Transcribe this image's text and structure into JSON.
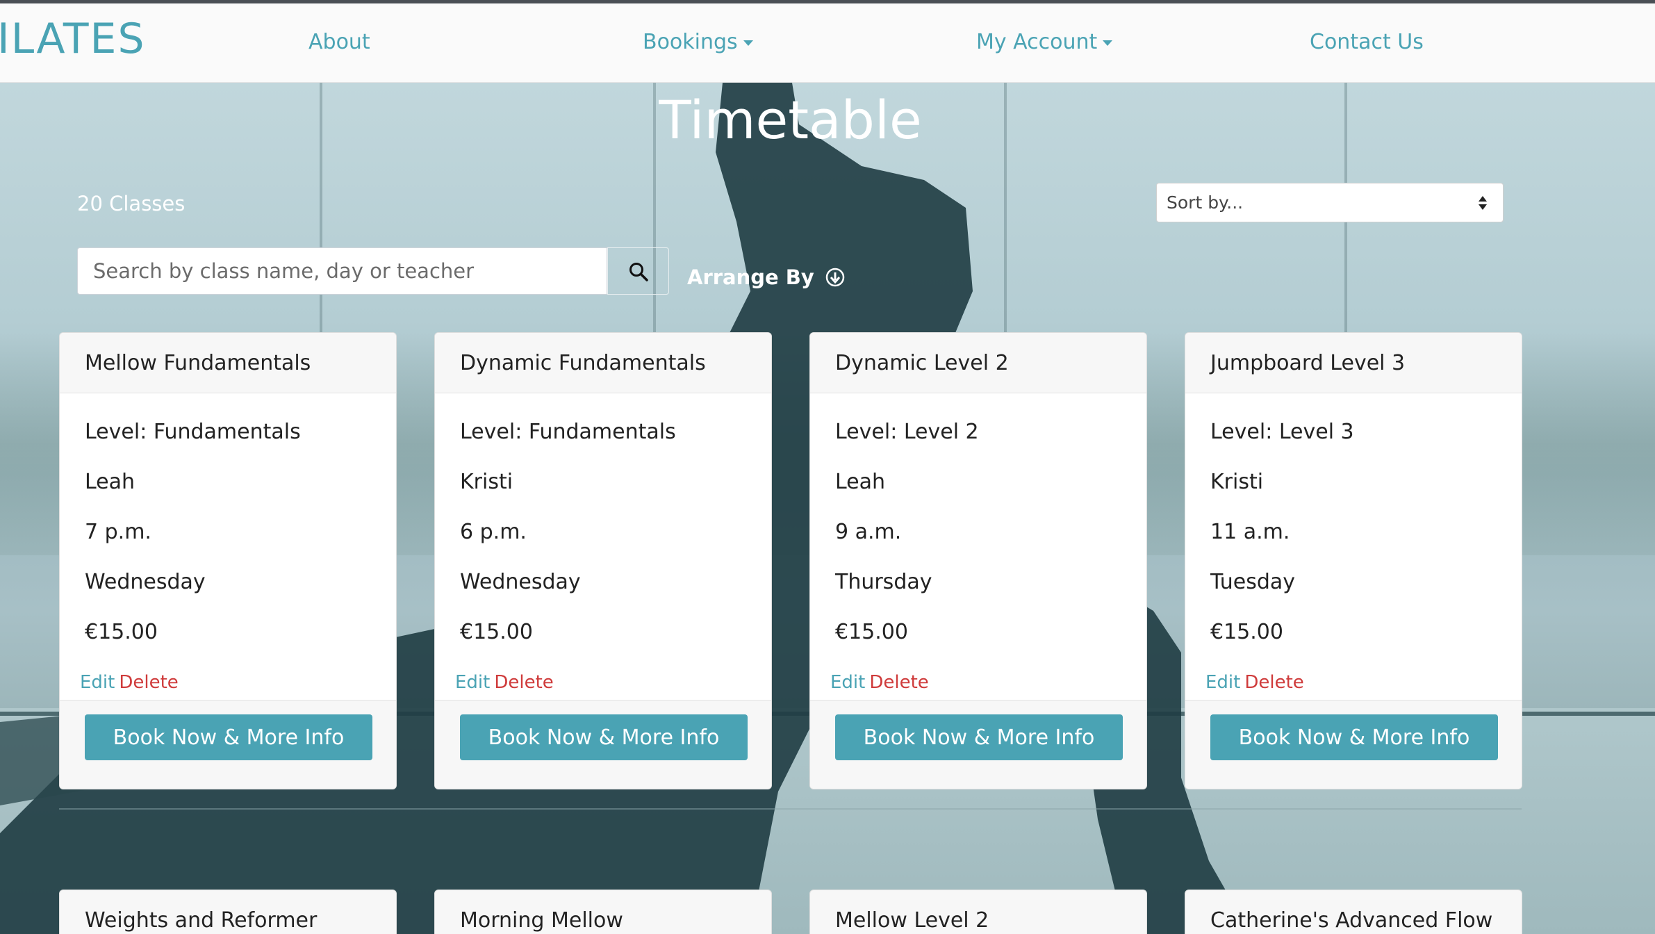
{
  "nav": {
    "brand": "ILATES",
    "about": "About",
    "bookings": "Bookings",
    "my_account": "My Account",
    "contact": "Contact Us"
  },
  "page": {
    "title": "Timetable",
    "class_count": "20 Classes",
    "sort_placeholder": "Sort by...",
    "search_placeholder": "Search by class name, day or teacher",
    "arrange_by": "Arrange By"
  },
  "cards": [
    {
      "name": "Mellow Fundamentals",
      "level": "Level: Fundamentals",
      "teacher": "Leah",
      "time": "7 p.m.",
      "day": "Wednesday",
      "price": "€15.00",
      "edit": "Edit",
      "delete": "Delete",
      "book": "Book Now & More Info"
    },
    {
      "name": "Dynamic Fundamentals",
      "level": "Level: Fundamentals",
      "teacher": "Kristi",
      "time": "6 p.m.",
      "day": "Wednesday",
      "price": "€15.00",
      "edit": "Edit",
      "delete": "Delete",
      "book": "Book Now & More Info"
    },
    {
      "name": "Dynamic Level 2",
      "level": "Level: Level 2",
      "teacher": "Leah",
      "time": "9 a.m.",
      "day": "Thursday",
      "price": "€15.00",
      "edit": "Edit",
      "delete": "Delete",
      "book": "Book Now & More Info"
    },
    {
      "name": "Jumpboard Level 3",
      "level": "Level: Level 3",
      "teacher": "Kristi",
      "time": "11 a.m.",
      "day": "Tuesday",
      "price": "€15.00",
      "edit": "Edit",
      "delete": "Delete",
      "book": "Book Now & More Info"
    }
  ],
  "next_cards": [
    {
      "name": "Weights and Reformer"
    },
    {
      "name": "Morning Mellow"
    },
    {
      "name": "Mellow Level 2"
    },
    {
      "name": "Catherine's Advanced Flow"
    }
  ],
  "colors": {
    "accent": "#4aa3b4",
    "delete": "#cf3b3b"
  },
  "icons": {
    "search": "search-icon",
    "arrange": "arrow-circle-down-icon",
    "dropdown": "chevron-down-icon",
    "sort": "sort-updown-icon"
  }
}
